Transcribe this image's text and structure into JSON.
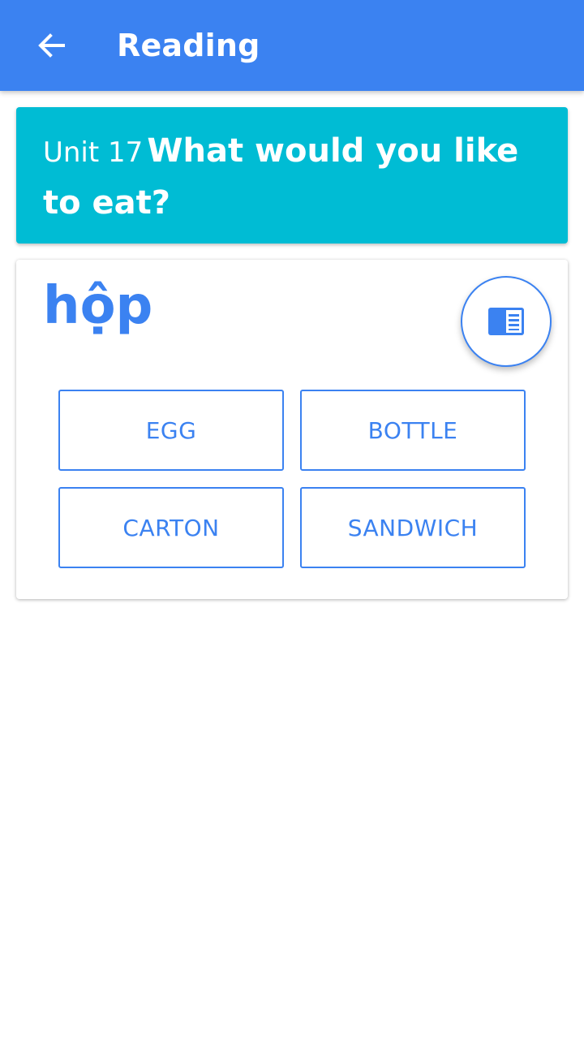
{
  "app_bar": {
    "title": "Reading",
    "back_icon": "arrow-left-icon",
    "background": "#3b82f1"
  },
  "unit": {
    "label": "Unit 17",
    "title": "What would you like to eat?",
    "background": "#00bcd4"
  },
  "quiz": {
    "prompt_word": "hộp",
    "reading_icon": "reading-mode-icon",
    "accent": "#3b82f1",
    "options": [
      {
        "label": "EGG"
      },
      {
        "label": "BOTTLE"
      },
      {
        "label": "CARTON"
      },
      {
        "label": "SANDWICH"
      }
    ]
  }
}
